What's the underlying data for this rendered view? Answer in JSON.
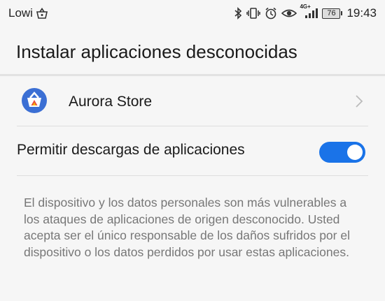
{
  "status_bar": {
    "carrier": "Lowi",
    "battery": "76",
    "time": "19:43",
    "network_label": "4G+"
  },
  "header": {
    "title": "Instalar aplicaciones desconocidas"
  },
  "app_row": {
    "name": "Aurora Store",
    "icon": "aurora-store-icon"
  },
  "setting": {
    "label": "Permitir descargas de aplicaciones",
    "enabled": true,
    "accent_color": "#1a73e8"
  },
  "warning": {
    "text": "El dispositivo y los datos personales son más vulnerables a los ataques de aplicaciones de origen desconocido. Usted acepta ser el único responsable de los daños sufridos por el dispositivo o los datos perdidos por usar estas aplicaciones."
  }
}
